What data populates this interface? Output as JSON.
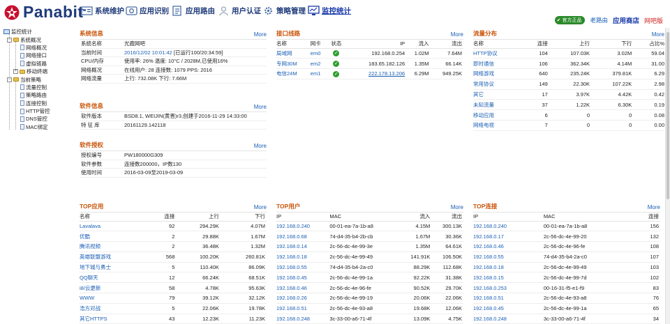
{
  "header": {
    "logo_text": "Panabit",
    "nav": [
      {
        "label": "系统维护",
        "icon": "tools-icon"
      },
      {
        "label": "应用识别",
        "icon": "app-id-icon"
      },
      {
        "label": "应用路由",
        "icon": "route-icon"
      },
      {
        "label": "用户认证",
        "icon": "user-auth-icon"
      },
      {
        "label": "策略管理",
        "icon": "policy-gear-icon"
      },
      {
        "label": "监控统计",
        "icon": "monitor-icon"
      }
    ],
    "badge": "官方正品",
    "old_route": "老路由",
    "app_store": "应用商店",
    "webmail": "网吧版"
  },
  "tree": {
    "root": "监控统计",
    "sys": "系统概况",
    "sys_items": [
      "网络概况",
      "网络接口",
      "虚拟链路",
      "移动终端"
    ],
    "policy": "当前策略",
    "policy_items": [
      "流量控制",
      "策略路由",
      "连接控制",
      "HTTP管控",
      "DNS管控",
      "MAC绑定"
    ]
  },
  "sysinfo": {
    "title": "系统信息",
    "more": "More",
    "rows": [
      {
        "k": "系统名称",
        "v": "光鹿网吧"
      },
      {
        "k": "当前时间",
        "v": "2016/12/02 10:01:42",
        "v2": " [已运行100/20:34:59]"
      },
      {
        "k": "CPU/内存",
        "v": "使用率: 26%  温度: 10°C  / 2028M,已使用16%"
      },
      {
        "k": "网络概况",
        "v": "在线用户: 28  连接数: 1079  PPS: 2016"
      },
      {
        "k": "网络流量",
        "v": "上行: 732.08K  下行: 7.66M"
      }
    ]
  },
  "softinfo": {
    "title": "软件信息",
    "more": "More",
    "rows": [
      {
        "k": "软件版本",
        "v": "BSD8.1, WEIJIN(黄晋)r3,创建于2016-11-29 14:33:00"
      },
      {
        "k": "特 征 库",
        "v": "20161129.142118"
      }
    ]
  },
  "license": {
    "title": "软件授权",
    "more": "More",
    "rows": [
      {
        "k": "授权编号",
        "v": "PW180000G309"
      },
      {
        "k": "软件参数",
        "v": "连接数200000，IP数130"
      },
      {
        "k": "使用时间",
        "v": "2016-03-09至2019-03-09"
      }
    ]
  },
  "links": {
    "title": "接口线路",
    "more": "More",
    "headers": [
      "名称",
      "网卡",
      "状态",
      "IP",
      "流入",
      "流出"
    ],
    "rows": [
      [
        "局域网",
        "em0",
        "",
        "192.168.0.254",
        "1.02M",
        "7.64M"
      ],
      [
        "专网30M",
        "em2",
        "",
        "183.65.182.126",
        "1.35M",
        "66.14K"
      ],
      [
        "电信24M",
        "em1",
        "",
        "222.178.13.206",
        "6.29M",
        "949.25K"
      ]
    ]
  },
  "flow": {
    "title": "流量分布",
    "more": "More",
    "headers": [
      "名称",
      "连接",
      "上行",
      "下行",
      "占比%"
    ],
    "rows": [
      [
        "HTTP协议",
        "104",
        "107.03K",
        "3.02M",
        "59.04"
      ],
      [
        "即时通信",
        "106",
        "362.34K",
        "4.14M",
        "31.00"
      ],
      [
        "网络游戏",
        "640",
        "235.24K",
        "379.81K",
        "6.29"
      ],
      [
        "常用协议",
        "149",
        "22.30K",
        "107.22K",
        "2.98"
      ],
      [
        "其它",
        "17",
        "3.97K",
        "4.42K",
        "0.42"
      ],
      [
        "未知流量",
        "37",
        "1.22K",
        "6.30K",
        "0.19"
      ],
      [
        "移动应用",
        "6",
        "0",
        "0",
        "0.08"
      ],
      [
        "网络电视",
        "7",
        "0",
        "0",
        "0.00"
      ]
    ]
  },
  "topapp": {
    "title": "TOP应用",
    "more": "More",
    "headers": [
      "名称",
      "连接",
      "上行",
      "下行"
    ],
    "rows": [
      [
        "Lavalava",
        "92",
        "294.29K",
        "4.07M"
      ],
      [
        "优酷",
        "2",
        "29.88K",
        "1.67M"
      ],
      [
        "腾讯视频",
        "2",
        "36.48K",
        "1.32M"
      ],
      [
        "英雄联盟游戏",
        "568",
        "100.20K",
        "260.81K"
      ],
      [
        "地下城与勇士",
        "5",
        "110.40K",
        "86.09K"
      ],
      [
        "QQ聊天",
        "12",
        "66.24K",
        "68.51K"
      ],
      [
        "i8/云更新",
        "58",
        "4.78K",
        "95.63K"
      ],
      [
        "WWW",
        "79",
        "39.12K",
        "32.12K"
      ],
      [
        "浩方对战",
        "5",
        "22.06K",
        "19.78K"
      ],
      [
        "其它HTTPS",
        "43",
        "12.23K",
        "11.23K"
      ]
    ]
  },
  "topuser": {
    "title": "TOP用户",
    "more": "More",
    "headers": [
      "IP",
      "MAC",
      "流入",
      "流出"
    ],
    "rows": [
      [
        "192.168.0.240",
        "00-01-ea-7a-1b-a8",
        "4.15M",
        "300.13K"
      ],
      [
        "192.168.0.68",
        "74-d4-35-b4-2b-cb",
        "1.67M",
        "30.36K"
      ],
      [
        "192.168.0.14",
        "2c-56-dc-4e-99-3e",
        "1.35M",
        "64.61K"
      ],
      [
        "192.168.0.18",
        "2c-56-dc-4e-99-49",
        "141.91K",
        "106.50K"
      ],
      [
        "192.168.0.55",
        "74-d4-35-b4-2a-c0",
        "88.29K",
        "112.68K"
      ],
      [
        "192.168.0.45",
        "2c-56-dc-4e-99-1a",
        "92.22K",
        "31.38K"
      ],
      [
        "192.168.0.46",
        "2c-56-dc-4e-96-fe",
        "90.52K",
        "29.70K"
      ],
      [
        "192.168.0.26",
        "2c-56-dc-4e-99-19",
        "20.06K",
        "22.06K"
      ],
      [
        "192.168.0.51",
        "2c-56-dc-4e-93-a8",
        "19.68K",
        "12.06K"
      ],
      [
        "192.168.0.248",
        "3c-33-00-a6-71-4f",
        "13.09K",
        "4.75K"
      ]
    ]
  },
  "topconn": {
    "title": "TOP连接",
    "more": "More",
    "headers": [
      "IP",
      "MAC",
      "连接"
    ],
    "rows": [
      [
        "192.168.0.240",
        "00-01-ea-7a-1b-a8",
        "156"
      ],
      [
        "192.168.0.17",
        "2c-56-dc-4e-99-20",
        "132"
      ],
      [
        "192.168.0.46",
        "2c-56-dc-4e-96-fe",
        "108"
      ],
      [
        "192.168.0.55",
        "74-d4-35-b4-2a-c0",
        "107"
      ],
      [
        "192.168.0.18",
        "2c-56-dc-4e-99-49",
        "103"
      ],
      [
        "192.168.0.15",
        "2c-56-dc-4e-99-7d",
        "102"
      ],
      [
        "192.168.0.253",
        "00-16-31-f5-e1-f9",
        "83"
      ],
      [
        "192.168.0.51",
        "2c-56-dc-4e-93-a8",
        "76"
      ],
      [
        "192.168.0.45",
        "2c-56-dc-4e-99-1a",
        "65"
      ],
      [
        "192.168.0.248",
        "3c-33-00-a6-71-4f",
        "34"
      ]
    ]
  }
}
